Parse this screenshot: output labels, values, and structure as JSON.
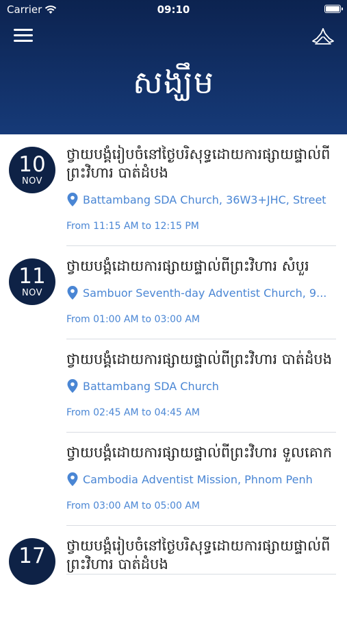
{
  "status": {
    "carrier": "Carrier",
    "time": "09:10"
  },
  "header": {
    "title": "សង្ឃឹម",
    "menu_icon": "hamburger-menu-icon",
    "logo_icon": "praying-hands-icon"
  },
  "colors": {
    "header_top": "#0c2350",
    "header_bottom": "#163a78",
    "badge": "#0e2246",
    "accent": "#4a86d4"
  },
  "events": [
    {
      "day": "10",
      "month": "NOV",
      "title": "ថ្វាយបង្គំរៀបចំនៅថ្ងៃបរិសុទ្ធដោយការផ្សាយផ្ទាល់ពីព្រះវិហារ បាត់ដំបង",
      "location": "Battambang SDA Church, 36W3+JHC, Street",
      "time": "From 11:15 AM to 12:15 PM"
    },
    {
      "day": "11",
      "month": "NOV",
      "title": "ថ្វាយបង្គំដោយការផ្សាយផ្ទាល់ពីព្រះវិហារ សំបួរ",
      "location": "Sambuor Seventh-day Adventist Church, 9...",
      "time": "From 01:00 AM to 03:00 AM"
    },
    {
      "day": "",
      "month": "",
      "title": "ថ្វាយបង្គំដោយការផ្សាយផ្ទាល់ពីព្រះវិហារ បាត់ដំបង",
      "location": "Battambang SDA Church",
      "time": "From 02:45 AM to 04:45 AM"
    },
    {
      "day": "",
      "month": "",
      "title": "ថ្វាយបង្គំដោយការផ្សាយផ្ទាល់ពីព្រះវិហារ ទួលគោក",
      "location": "Cambodia Adventist Mission, Phnom Penh",
      "time": "From 03:00 AM to 05:00 AM"
    },
    {
      "day": "17",
      "month": "",
      "title": "ថ្វាយបង្គំរៀបចំនៅថ្ងៃបរិសុទ្ធដោយការផ្សាយផ្ទាល់ពីព្រះវិហារ បាត់ដំបង",
      "location": "",
      "time": ""
    }
  ]
}
